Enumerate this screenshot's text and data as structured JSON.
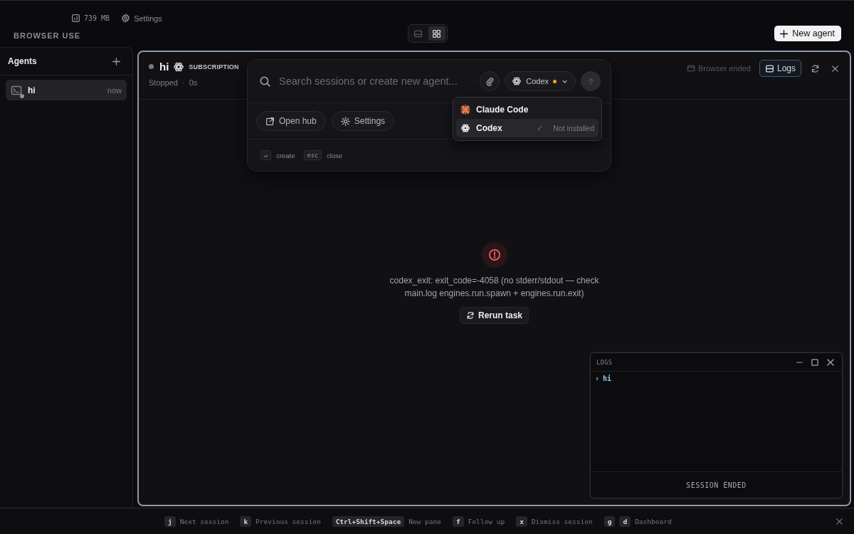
{
  "top_bar": {
    "memory": "739 MB",
    "settings": "Settings",
    "brand": "BROWSER USE",
    "layout_toggle": [
      {
        "kind": "single",
        "selected": false
      },
      {
        "kind": "grid",
        "selected": true
      }
    ],
    "new_agent": "New agent"
  },
  "sidebar": {
    "title": "Agents",
    "items": [
      {
        "name": "hi",
        "time": "now",
        "selected": true
      }
    ]
  },
  "session": {
    "title": "hi",
    "badge": "SUBSCRIPTION",
    "status": "Stopped",
    "separator": "·",
    "duration": "0s",
    "browser_status": {
      "label": "Browser ended",
      "disabled": true
    },
    "logs_button": {
      "label": "Logs",
      "on": true
    }
  },
  "error": {
    "message": "codex_exit: exit_code=-4058 (no stderr/stdout — check main.log engines.run.spawn + engines.run.exit)",
    "action": "Rerun task"
  },
  "logs_panel": {
    "title": "LOGS",
    "lines": [
      {
        "prompt": "›",
        "text": "hi"
      }
    ],
    "footer": "SESSION ENDED"
  },
  "command_palette": {
    "placeholder": "Search sessions or create new agent...",
    "engine": {
      "label": "Codex",
      "warning": true
    },
    "send_disabled": true,
    "engines": [
      {
        "kind": "claude",
        "label": "Claude Code",
        "selected": false
      },
      {
        "kind": "openai",
        "label": "Codex",
        "selected": true,
        "check": "✓",
        "note": "Not installed"
      }
    ],
    "actions": [
      {
        "kind": "external",
        "label": "Open hub"
      },
      {
        "kind": "settings",
        "label": "Settings"
      }
    ],
    "hints": [
      {
        "key": "↵",
        "label": "create"
      },
      {
        "key": "esc",
        "label": "close"
      }
    ]
  },
  "shortcuts": [
    {
      "keys": [
        "j"
      ],
      "label": "Next session"
    },
    {
      "keys": [
        "k"
      ],
      "label": "Previous session"
    },
    {
      "keys": [
        "Ctrl+Shift+Space"
      ],
      "label": "New pane"
    },
    {
      "keys": [
        "f"
      ],
      "label": "Follow up"
    },
    {
      "keys": [
        "x"
      ],
      "label": "Dismiss session"
    },
    {
      "keys": [
        "g",
        "d"
      ],
      "label": "Dashboard"
    }
  ]
}
